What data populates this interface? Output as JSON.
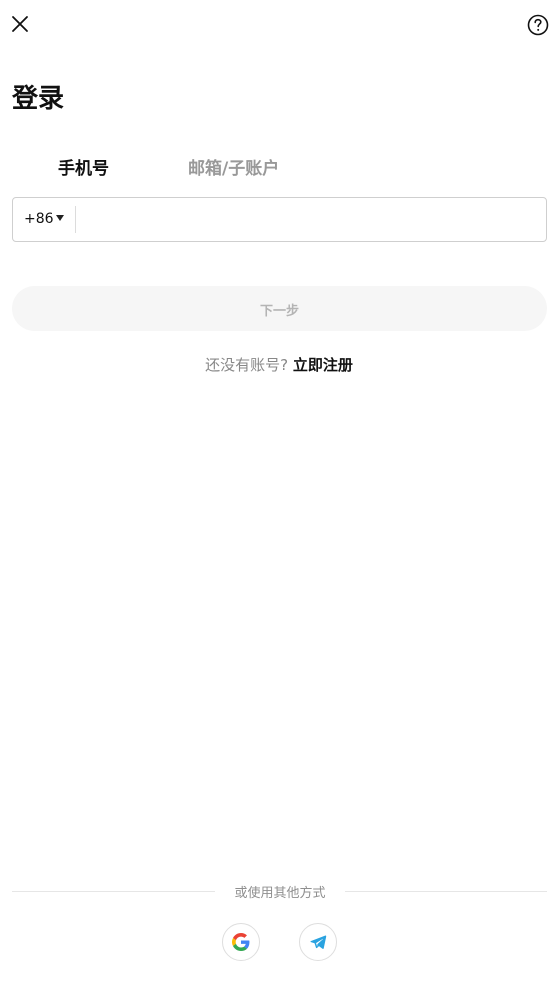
{
  "header": {
    "close_icon": "close-icon",
    "help_icon": "help-circle-icon"
  },
  "page": {
    "title": "登录"
  },
  "tabs": [
    {
      "label": "手机号",
      "active": true
    },
    {
      "label": "邮箱/子账户",
      "active": false
    }
  ],
  "phone": {
    "country_code": "+86",
    "value": "",
    "placeholder": ""
  },
  "next_button": {
    "label": "下一步",
    "enabled": false
  },
  "register": {
    "prompt": "还没有账号?",
    "link": "立即注册"
  },
  "other_login": {
    "label": "或使用其他方式",
    "providers": [
      {
        "icon": "google-icon"
      },
      {
        "icon": "telegram-icon"
      }
    ]
  },
  "colors": {
    "text_primary": "#111111",
    "text_muted": "#888888",
    "disabled_button_bg": "#f6f6f6",
    "disabled_button_text": "#b4b4b4",
    "telegram": "#2aa3e0"
  }
}
